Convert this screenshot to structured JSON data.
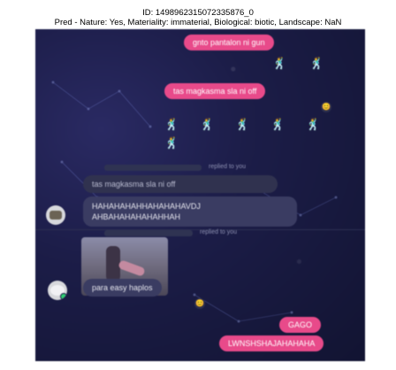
{
  "caption": {
    "id_line": "ID: 1498962315072335876_0",
    "pred_line": "Pred - Nature: Yes, Materiality: immaterial, Biological: biotic, Landscape: NaN"
  },
  "messages": {
    "out_1": "gnto pantalon ni gun",
    "out_2": "tas magkasma sla ni off",
    "replied_label_1": "replied to you",
    "quoted_1": "tas magkasma sla ni off",
    "in_1": "HAHAHAHAHHAHAHAHAVDJ AHBAHAHAHAHAHHAH",
    "replied_label_2": "replied to you",
    "in_2": "para easy haplos",
    "out_3": "GAGO",
    "out_4": "LWNSHSHAJAHAHAHA"
  },
  "icons": {
    "emoji_dancer": "🕺",
    "reaction": "😊"
  },
  "colors": {
    "outgoing_bubble": "#e84a8a",
    "incoming_bubble": "#3a3c62",
    "background": "#1c1d48"
  }
}
